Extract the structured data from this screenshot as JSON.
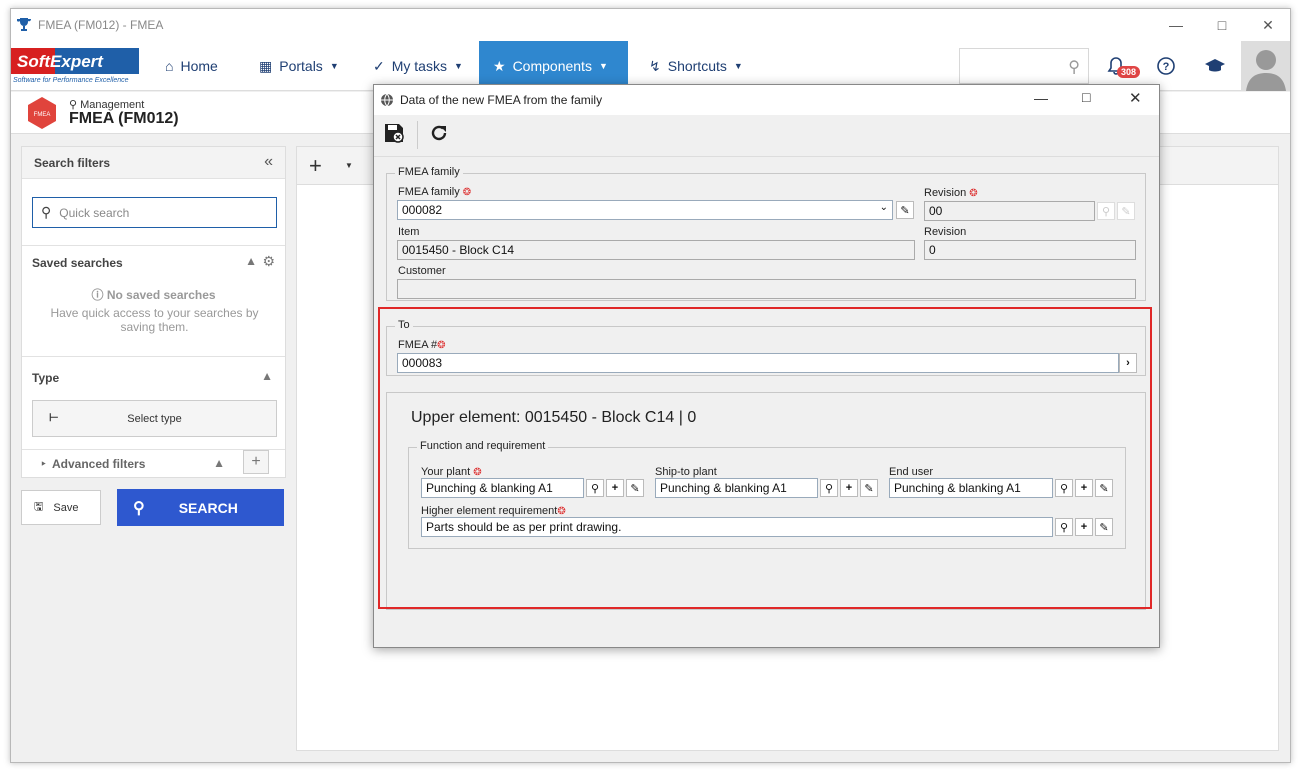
{
  "window": {
    "title": "FMEA (FM012) - FMEA"
  },
  "logo": {
    "brand": "SoftExpert",
    "tagline": "Software for Performance Excellence"
  },
  "nav": {
    "items": [
      {
        "label": "Home",
        "icon": "home-icon"
      },
      {
        "label": "Portals",
        "icon": "grid-icon"
      },
      {
        "label": "My tasks",
        "icon": "check-icon"
      },
      {
        "label": "Components",
        "icon": "trophy-icon"
      },
      {
        "label": "Shortcuts",
        "icon": "bolt-icon"
      }
    ],
    "notifications": "308"
  },
  "page": {
    "breadcrumb": "Management",
    "title": "FMEA (FM012)"
  },
  "filters": {
    "title": "Search filters",
    "quick_search_placeholder": "Quick search",
    "saved_searches": "Saved searches",
    "no_saved": "No saved searches",
    "no_saved_hint": "Have quick access to your searches by saving them.",
    "type": "Type",
    "select_type": "Select type",
    "advanced": "Advanced filters",
    "save": "Save",
    "search": "SEARCH"
  },
  "modal": {
    "title": "Data of the new FMEA from the family",
    "fmea_family": {
      "legend": "FMEA family",
      "family_label": "FMEA family",
      "family_value": "000082",
      "revision_label": "Revision",
      "revision_value": "00",
      "item_label": "Item",
      "item_value": "0015450 - Block C14",
      "item_revision_label": "Revision",
      "item_revision_value": "0",
      "customer_label": "Customer",
      "customer_value": ""
    },
    "to": {
      "legend": "To",
      "fmea_label": "FMEA #",
      "fmea_value": "000083"
    },
    "upper": {
      "title": "Upper element: 0015450 - Block C14 | 0",
      "legend": "Function and requirement",
      "your_plant_label": "Your plant",
      "your_plant_value": "Punching & blanking A1",
      "ship_label": "Ship-to plant",
      "ship_value": "Punching & blanking A1",
      "end_user_label": "End user",
      "end_user_value": "Punching & blanking A1",
      "higher_label": "Higher element requirement",
      "higher_value": "Parts should be as per print drawing."
    }
  }
}
